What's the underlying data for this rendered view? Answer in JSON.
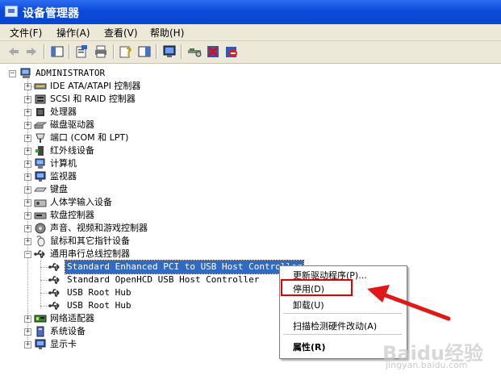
{
  "window": {
    "title": "设备管理器"
  },
  "menu": [
    "文件(F)",
    "操作(A)",
    "查看(V)",
    "帮助(H)"
  ],
  "tree": {
    "root": "ADMINISTRATOR",
    "categories": [
      {
        "label": "IDE ATA/ATAPI 控制器"
      },
      {
        "label": "SCSI 和 RAID 控制器"
      },
      {
        "label": "处理器"
      },
      {
        "label": "磁盘驱动器"
      },
      {
        "label": "端口 (COM 和 LPT)"
      },
      {
        "label": "红外线设备"
      },
      {
        "label": "计算机"
      },
      {
        "label": "监视器"
      },
      {
        "label": "键盘"
      },
      {
        "label": "人体学输入设备"
      },
      {
        "label": "软盘控制器"
      },
      {
        "label": "声音、视频和游戏控制器"
      },
      {
        "label": "鼠标和其它指针设备"
      },
      {
        "label": "通用串行总线控制器"
      }
    ],
    "usb_children": [
      "Standard Enhanced PCI to USB Host Controller",
      "Standard OpenHCD USB Host Controller",
      "USB Root Hub",
      "USB Root Hub"
    ],
    "after_categories": [
      {
        "label": "网络适配器"
      },
      {
        "label": "系统设备"
      },
      {
        "label": "显示卡"
      }
    ]
  },
  "context_menu": {
    "update_driver": "更新驱动程序(P)...",
    "disable": "停用(D)",
    "uninstall": "卸载(U)",
    "scan": "扫描检测硬件改动(A)",
    "properties": "属性(R)"
  },
  "watermark": {
    "text": "Baidu经验",
    "sub": "jingyan.baidu.com"
  },
  "colors": {
    "titlebar": "#0a4ad8",
    "selection": "#316ac5",
    "highlight": "#e00000"
  }
}
